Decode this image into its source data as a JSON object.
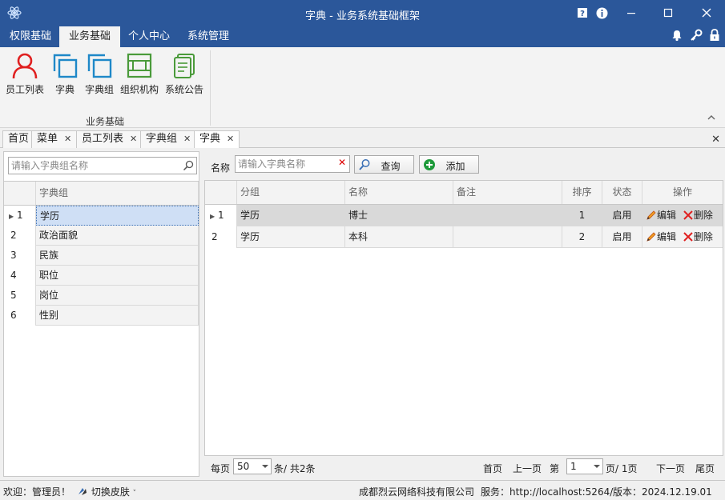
{
  "window": {
    "title": "字典 - 业务系统基础框架",
    "controls": [
      "help-icon",
      "info-icon",
      "minimize-icon",
      "maximize-icon",
      "close-icon"
    ]
  },
  "ribbon": {
    "tabs": [
      {
        "label": "权限基础",
        "active": false
      },
      {
        "label": "业务基础",
        "active": true
      },
      {
        "label": "个人中心",
        "active": false
      },
      {
        "label": "系统管理",
        "active": false
      }
    ],
    "right_icons": [
      "bell-icon",
      "key-icon",
      "lock-icon"
    ],
    "buttons": [
      {
        "label": "员工列表",
        "icon": "user-icon"
      },
      {
        "label": "字典",
        "icon": "copy-icon"
      },
      {
        "label": "字典组",
        "icon": "copy-icon"
      },
      {
        "label": "组织机构",
        "icon": "org-icon"
      },
      {
        "label": "系统公告",
        "icon": "notice-icon"
      }
    ],
    "group_label": "业务基础"
  },
  "doc_tabs": [
    {
      "label": "首页",
      "closable": false,
      "active": false
    },
    {
      "label": "菜单",
      "closable": true,
      "active": false
    },
    {
      "label": "员工列表",
      "closable": true,
      "active": false
    },
    {
      "label": "字典组",
      "closable": true,
      "active": false
    },
    {
      "label": "字典",
      "closable": true,
      "active": true
    }
  ],
  "left": {
    "search_placeholder": "请输入字典组名称",
    "header": "字典组",
    "rows": [
      {
        "num": "1",
        "name": "学历",
        "selected": true
      },
      {
        "num": "2",
        "name": "政治面貌",
        "selected": false
      },
      {
        "num": "3",
        "name": "民族",
        "selected": false
      },
      {
        "num": "4",
        "name": "职位",
        "selected": false
      },
      {
        "num": "5",
        "name": "岗位",
        "selected": false
      },
      {
        "num": "6",
        "name": "性别",
        "selected": false
      }
    ]
  },
  "toolbar": {
    "name_label": "名称",
    "name_placeholder": "请输入字典名称",
    "query_label": "查询",
    "add_label": "添加"
  },
  "table": {
    "columns": [
      "分组",
      "名称",
      "备注",
      "排序",
      "状态",
      "操作"
    ],
    "rows": [
      {
        "num": "1",
        "group": "学历",
        "name": "博士",
        "remark": "",
        "order": "1",
        "status": "启用"
      },
      {
        "num": "2",
        "group": "学历",
        "name": "本科",
        "remark": "",
        "order": "2",
        "status": "启用"
      }
    ],
    "edit_label": "编辑",
    "delete_label": "删除"
  },
  "pager": {
    "per_page_label": "每页",
    "page_size": "50",
    "total_label": "条/ 共2条",
    "first": "首页",
    "prev": "上一页",
    "page_label": "第",
    "page": "1",
    "page_total": "页/ 1页",
    "next": "下一页",
    "last": "尾页"
  },
  "status": {
    "welcome": "欢迎：管理员！",
    "skin": "切换皮肤",
    "company": "成都烈云网络科技有限公司",
    "server": "服务：http://localhost:5264/",
    "version": "版本：2024.12.19.01"
  },
  "colors": {
    "titlebar": "#2b579a",
    "selected_row": "#cfdff5",
    "user_icon": "#e02020",
    "copy_icon": "#1e88c8",
    "green_icon": "#4a9a3a"
  }
}
